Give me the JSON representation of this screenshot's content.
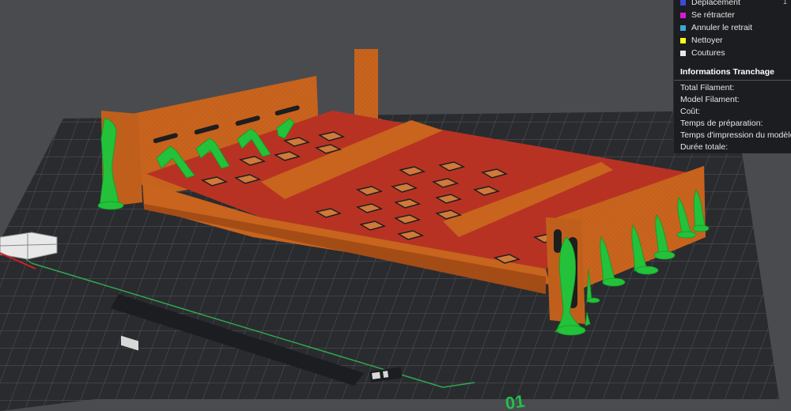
{
  "legend": {
    "items": [
      {
        "label": "Déplacement",
        "color": "#3b4bd6"
      },
      {
        "label": "Se rétracter",
        "color": "#d81ad8"
      },
      {
        "label": "Annuler le retrait",
        "color": "#3fa8d8"
      },
      {
        "label": "Nettoyer",
        "color": "#ffff19"
      },
      {
        "label": "Coutures",
        "color": "#e8e8e8"
      }
    ],
    "corner_value": "1"
  },
  "slice_info": {
    "title": "Informations Tranchage",
    "rows": [
      {
        "label": "Total Filament:"
      },
      {
        "label": "Model Filament:"
      },
      {
        "label": "Coût:"
      },
      {
        "label": "Temps de préparation:"
      },
      {
        "label": "Temps d'impression du modèle:"
      },
      {
        "label": "Durée totale:"
      }
    ]
  },
  "plate": {
    "number_label": "01"
  },
  "colors": {
    "background": "#4a4b4f",
    "bed_grid": "#2e2f33",
    "wall_orange": "#c8641d",
    "infill_red": "#b83224",
    "support_green": "#23c23a"
  }
}
